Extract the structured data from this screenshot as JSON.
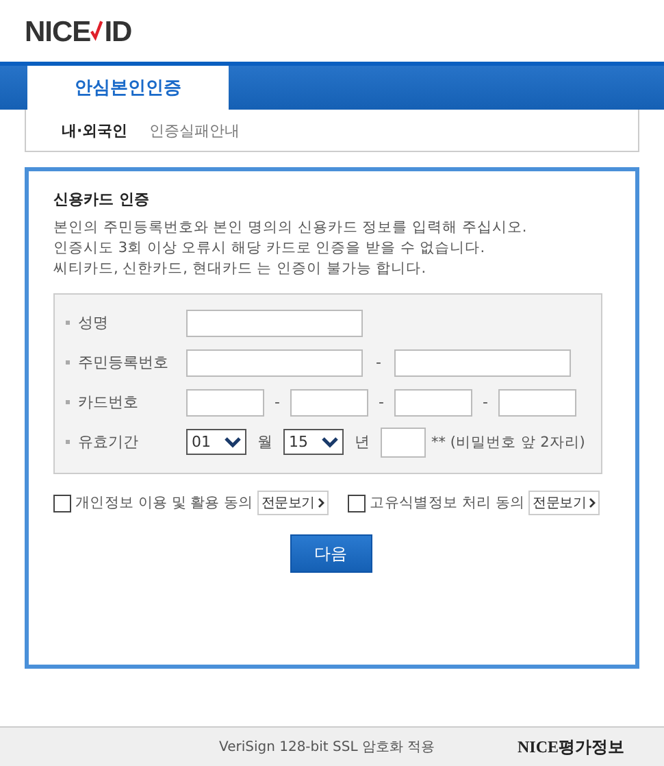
{
  "logo": {
    "text": "NICE",
    "suffix": "ID"
  },
  "main_tabs": [
    {
      "label": "안심본인인증",
      "selected": true
    }
  ],
  "sub_tabs": [
    {
      "label": "내·외국인",
      "selected": true
    },
    {
      "label": "인증실패안내",
      "selected": false
    }
  ],
  "section_title": "신용카드 인증",
  "description": [
    "본인의 주민등록번호와 본인 명의의 신용카드 정보를 입력해 주십시오.",
    "인증시도 3회 이상 오류시 해당 카드로 인증을 받을 수 없습니다.",
    "씨티카드, 신한카드, 현대카드 는 인증이 불가능 합니다."
  ],
  "form_rows": [
    {
      "kind": "name",
      "label": "성명"
    },
    {
      "kind": "rrn",
      "label": "주민등록번호",
      "separator": "-"
    },
    {
      "kind": "card",
      "label": "카드번호",
      "separators": [
        "-",
        "-",
        "-"
      ]
    },
    {
      "kind": "expiry",
      "label": "유효기간",
      "month": "01",
      "month_unit": "월",
      "year": "15",
      "year_unit": "년",
      "hint": "** (비밀번호 앞 2자리)"
    }
  ],
  "agreements": [
    {
      "label": "개인정보 이용 및 활용 동의",
      "checked": false,
      "link": "전문보기"
    },
    {
      "label": "고유식별정보 처리 동의",
      "checked": false,
      "link": "전문보기"
    }
  ],
  "next_button": "다음",
  "footer": {
    "notice": "VeriSign 128-bit SSL 암호화 적용",
    "brand": "NICE평가정보"
  }
}
